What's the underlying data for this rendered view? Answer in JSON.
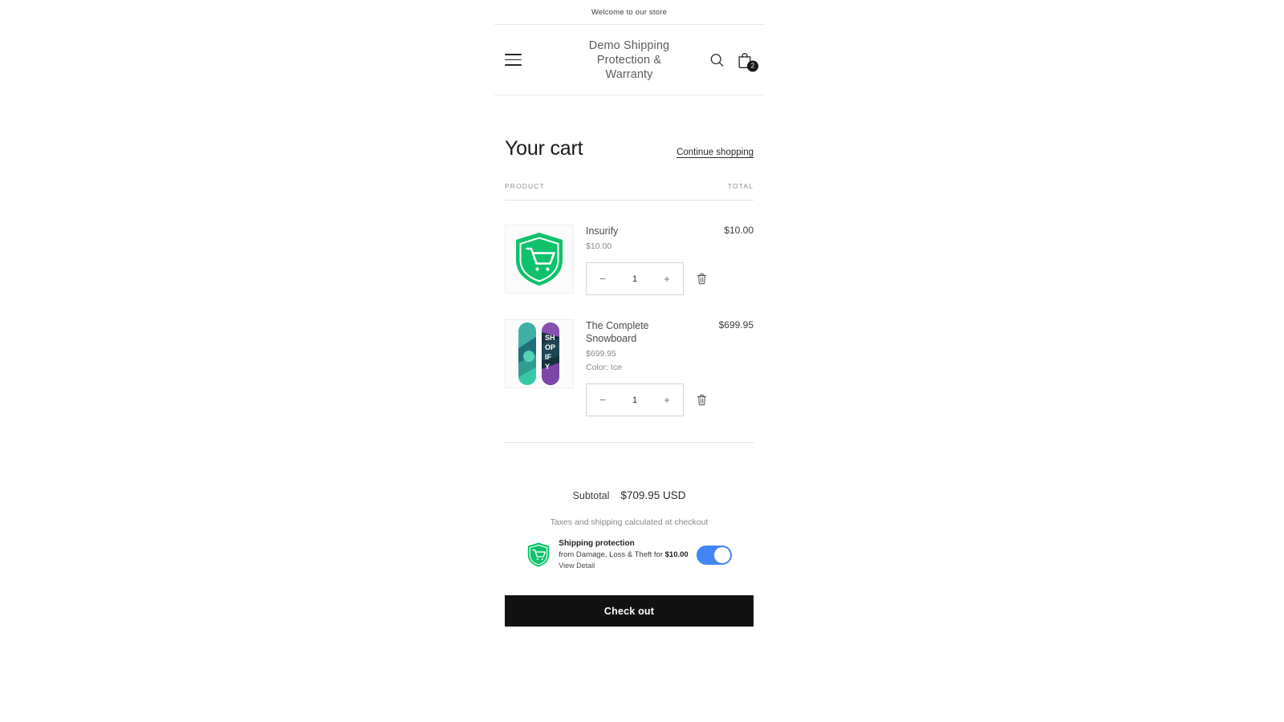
{
  "announcement": {
    "text": "Welcome to our store"
  },
  "header": {
    "menu_icon": "hamburger-menu-icon",
    "store_title": "Demo Shipping Protection & Warranty",
    "search_icon": "search-icon",
    "cart_icon": "shopping-bag-icon",
    "cart_count": "2"
  },
  "cart": {
    "title": "Your cart",
    "continue_label": "Continue shopping",
    "col_product": "PRODUCT",
    "col_total": "TOTAL",
    "items": [
      {
        "name": "Insurify",
        "price": "$10.00",
        "variant": "",
        "line_total": "$10.00",
        "quantity": "1",
        "minus_label": "−",
        "plus_label": "+",
        "thumb": "shield-cart-logo",
        "remove_icon": "trash-icon"
      },
      {
        "name": "The Complete Snowboard",
        "price": "$699.95",
        "variant": "Color: Ice",
        "line_total": "$699.95",
        "quantity": "1",
        "minus_label": "−",
        "plus_label": "+",
        "thumb": "snowboard-pair-image",
        "remove_icon": "trash-icon"
      }
    ],
    "subtotal_label": "Subtotal",
    "subtotal_value": "$709.95 USD",
    "tax_note": "Taxes and shipping calculated at checkout",
    "checkout_label": "Check out"
  },
  "protection": {
    "icon": "shield-cart-logo",
    "title": "Shipping protection",
    "subtitle_prefix": "from Damage, Loss & Theft for ",
    "subtitle_amount": "$10.00",
    "detail_link": "View Detail",
    "toggle_state": "on",
    "toggle_color": "#4285f4"
  },
  "colors": {
    "brand_green": "#0ec26b",
    "checkout_bg": "#121212",
    "toggle_on": "#4285f4",
    "title_gray": "#5d5d5d"
  }
}
